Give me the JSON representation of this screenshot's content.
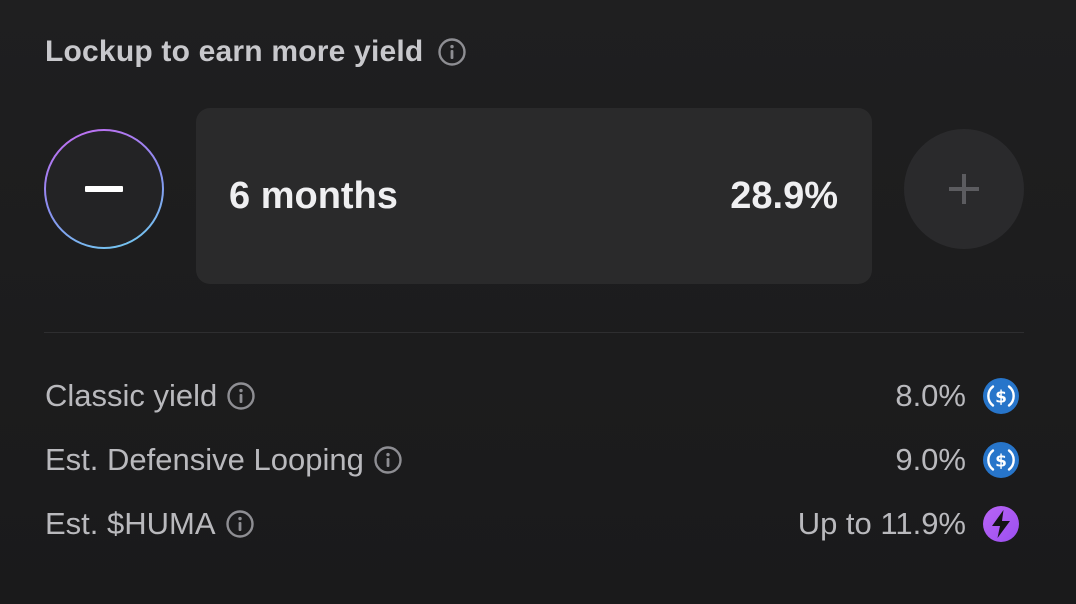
{
  "lockup": {
    "title": "Lockup to earn more yield",
    "duration": "6 months",
    "apy": "28.9%"
  },
  "yields": [
    {
      "label": "Classic yield",
      "value": "8.0%",
      "token_icon": "usdc-icon"
    },
    {
      "label": "Est. Defensive Looping",
      "value": "9.0%",
      "token_icon": "usdc-icon"
    },
    {
      "label": "Est. $HUMA",
      "value": "Up to 11.9%",
      "token_icon": "huma-icon"
    }
  ],
  "colors": {
    "background": "#1c1c1d",
    "value_box": "#2a2a2b",
    "usdc_blue": "#2775ca",
    "huma_purple": "#a855f7",
    "minus_ring_gradient": [
      "#c86af2",
      "#8a8ff0",
      "#6fd0f0"
    ]
  }
}
